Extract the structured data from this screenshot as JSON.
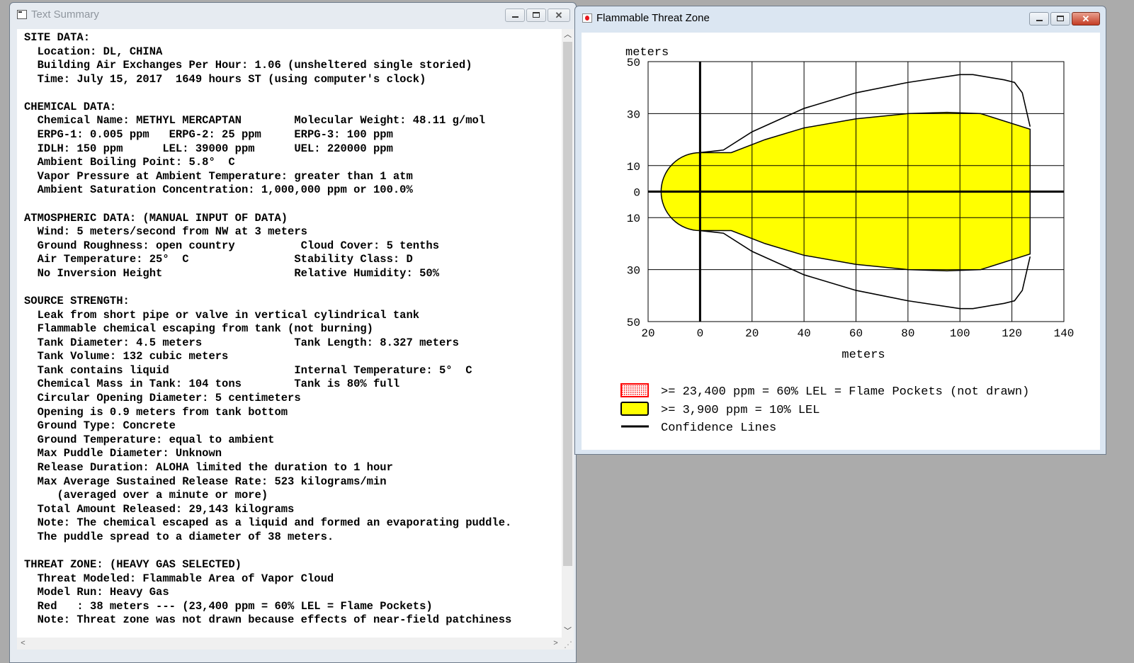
{
  "summary_window": {
    "title": "Text Summary",
    "lines": [
      "SITE DATA:",
      "  Location: DL, CHINA",
      "  Building Air Exchanges Per Hour: 1.06 (unsheltered single storied)",
      "  Time: July 15, 2017  1649 hours ST (using computer's clock)",
      "",
      "CHEMICAL DATA:",
      "  Chemical Name: METHYL MERCAPTAN        Molecular Weight: 48.11 g/mol",
      "  ERPG-1: 0.005 ppm   ERPG-2: 25 ppm     ERPG-3: 100 ppm",
      "  IDLH: 150 ppm      LEL: 39000 ppm      UEL: 220000 ppm",
      "  Ambient Boiling Point: 5.8°  C",
      "  Vapor Pressure at Ambient Temperature: greater than 1 atm",
      "  Ambient Saturation Concentration: 1,000,000 ppm or 100.0%",
      "",
      "ATMOSPHERIC DATA: (MANUAL INPUT OF DATA)",
      "  Wind: 5 meters/second from NW at 3 meters",
      "  Ground Roughness: open country          Cloud Cover: 5 tenths",
      "  Air Temperature: 25°  C                Stability Class: D",
      "  No Inversion Height                    Relative Humidity: 50%",
      "",
      "SOURCE STRENGTH:",
      "  Leak from short pipe or valve in vertical cylindrical tank",
      "  Flammable chemical escaping from tank (not burning)",
      "  Tank Diameter: 4.5 meters              Tank Length: 8.327 meters",
      "  Tank Volume: 132 cubic meters",
      "  Tank contains liquid                   Internal Temperature: 5°  C",
      "  Chemical Mass in Tank: 104 tons        Tank is 80% full",
      "  Circular Opening Diameter: 5 centimeters",
      "  Opening is 0.9 meters from tank bottom",
      "  Ground Type: Concrete",
      "  Ground Temperature: equal to ambient",
      "  Max Puddle Diameter: Unknown",
      "  Release Duration: ALOHA limited the duration to 1 hour",
      "  Max Average Sustained Release Rate: 523 kilograms/min",
      "     (averaged over a minute or more)",
      "  Total Amount Released: 29,143 kilograms",
      "  Note: The chemical escaped as a liquid and formed an evaporating puddle.",
      "  The puddle spread to a diameter of 38 meters.",
      "",
      "THREAT ZONE: (HEAVY GAS SELECTED)",
      "  Threat Modeled: Flammable Area of Vapor Cloud",
      "  Model Run: Heavy Gas",
      "  Red   : 38 meters --- (23,400 ppm = 60% LEL = Flame Pockets)",
      "  Note: Threat zone was not drawn because effects of near-field patchiness"
    ]
  },
  "threat_window": {
    "title": "Flammable Threat Zone",
    "legend": [
      {
        "label": ">= 23,400 ppm = 60% LEL = Flame Pockets (not drawn)",
        "swatch": "hatched-red"
      },
      {
        "label": ">= 3,900 ppm = 10% LEL",
        "swatch": "yellow"
      },
      {
        "label": "Confidence Lines",
        "swatch": "line"
      }
    ]
  },
  "chart_data": {
    "type": "area",
    "xlabel": "meters",
    "ylabel": "meters",
    "xlim": [
      -20,
      140
    ],
    "ylim": [
      -50,
      50
    ],
    "x_ticks": [
      -20,
      0,
      20,
      40,
      60,
      80,
      100,
      120,
      140
    ],
    "x_tick_labels": [
      "20",
      "0",
      "20",
      "40",
      "60",
      "80",
      "100",
      "120",
      "140"
    ],
    "y_ticks": [
      50,
      30,
      10,
      0,
      -10,
      -30,
      -50
    ],
    "y_tick_labels": [
      "50",
      "30",
      "10",
      "0",
      "10",
      "30",
      "50"
    ],
    "grid": true,
    "colors": {
      "threat": "#ffff00",
      "outline": "#000000",
      "flame": "#ff0000"
    },
    "threat_zone_upper": [
      [
        0,
        15
      ],
      [
        12,
        15
      ],
      [
        25,
        20
      ],
      [
        40,
        24.5
      ],
      [
        60,
        28
      ],
      [
        80,
        30
      ],
      [
        95,
        30.5
      ],
      [
        108,
        30
      ],
      [
        127,
        24
      ]
    ],
    "source_radius": 15,
    "confidence_upper": [
      [
        0,
        15
      ],
      [
        9,
        16
      ],
      [
        20,
        23
      ],
      [
        40,
        32
      ],
      [
        60,
        38
      ],
      [
        80,
        42
      ],
      [
        100,
        45
      ],
      [
        105,
        45
      ],
      [
        117,
        43
      ],
      [
        121,
        42
      ],
      [
        124,
        38
      ],
      [
        127,
        25
      ]
    ]
  }
}
